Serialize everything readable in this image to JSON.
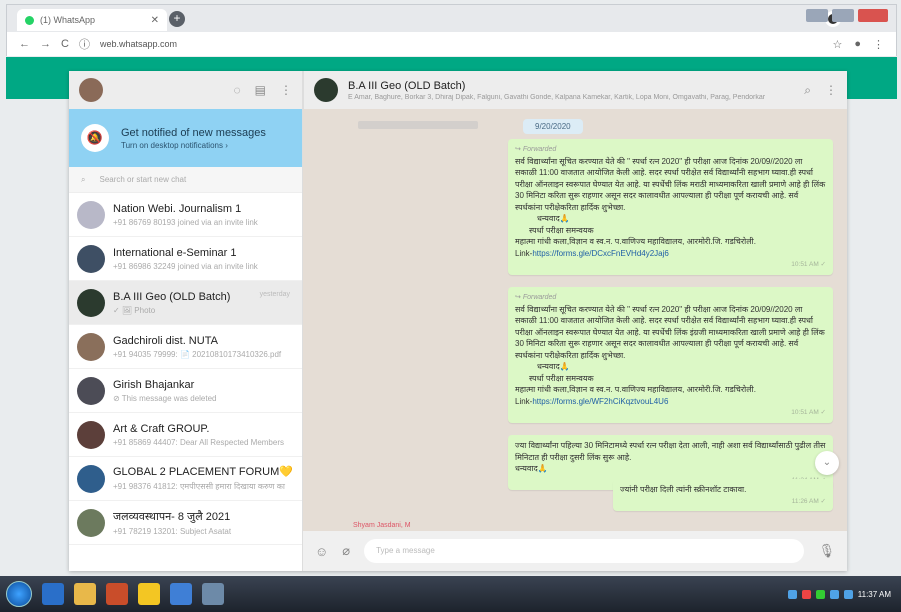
{
  "browser": {
    "tab_title": "(1) WhatsApp",
    "url": "web.whatsapp.com"
  },
  "notify": {
    "title": "Get notified of new messages",
    "subtitle": "Turn on desktop notifications ›"
  },
  "search": {
    "placeholder": "Search or start new chat"
  },
  "chats": [
    {
      "name": "Nation Webi. Journalism 1",
      "preview": "+91 86769 80193 joined via an invite link",
      "time": ""
    },
    {
      "name": "International e-Seminar 1",
      "preview": "+91 86986 32249 joined via an invite link",
      "time": ""
    },
    {
      "name": "B.A III Geo (OLD Batch)",
      "preview": "✓ 🖼 Photo",
      "time": "yesterday"
    },
    {
      "name": "Gadchiroli dist. NUTA",
      "preview": "+91 94035 79999: 📄 20210810173410326.pdf",
      "time": ""
    },
    {
      "name": "Girish Bhajankar",
      "preview": "⊘ This message was deleted",
      "time": ""
    },
    {
      "name": "Art & Craft  GROUP.",
      "preview": "+91 85869 44407: Dear All Respected Members",
      "time": ""
    },
    {
      "name": "GLOBAL 2 PLACEMENT FORUM💛",
      "preview": "+91 98376 41812: एमपीएससी हमारा दिखाया करुण का",
      "time": ""
    },
    {
      "name": "जलव्यवस्थापन- 8 जुलै 2021",
      "preview": "+91 78219 13201: Subject Asatat",
      "time": ""
    }
  ],
  "conversation": {
    "title": "B.A III Geo (OLD Batch)",
    "members": "E Amar, Baghure, Borkar 3, Dhiraj Dipak, Falguni, Gavathi Gonde, Kalpana Kamekar, Kartik, Lopa Moni, Omgavathi, Parag, Pendorkar",
    "date": "9/20/2020",
    "messages": [
      {
        "forwarded": "Forwarded",
        "text": "सर्व विद्यार्थ्यांना सूचित करण्यात येते की \" स्पर्धा रत्न 2020\" ही परीक्षा आज दिनांक 20/09//2020 ला सकाळी 11:00 वाजतात आयोजित केली आहे. सदर स्पर्धा परीक्षेत सर्व विद्यार्थ्यांनी सहभाग घ्यावा.ही स्पर्धा परीक्षा ऑनलाइन स्वरूपात घेण्यात येत आहे. या स्पर्धेची लिंक मराठी माध्यमाकरिता खाली प्रमाणे आहे ही लिंक 30 मिनिटा करिता सुरू राहणार असून सदर कालावधीत आपल्याला ही परीक्षा पूर्ण करायची आहे. सर्व स्पर्धकांना परीक्षेकरिता हार्दिक शुभेच्छा.",
        "sig1": "धन्यवाद🙏",
        "sig2": "स्पर्धा परीक्षा समन्वयक",
        "sig3": "महात्मा गांधी कला,विज्ञान व स्व.न. प.वाणिज्य महाविद्यालय, आरमोरी.जि. गडचिरोली.",
        "link_label": "Link-",
        "link": "https://forms.gle/DCxcFnEVHd4y2Jaj6",
        "time": "10:51 AM ✓"
      },
      {
        "forwarded": "Forwarded",
        "text": "सर्व विद्यार्थ्यांना सूचित करण्यात येते की \" स्पर्धा रत्न 2020\" ही परीक्षा आज दिनांक 20/09//2020 ला सकाळी 11:00 वाजतात आयोजित केली आहे. सदर स्पर्धा परीक्षेत सर्व विद्यार्थ्यांनी सहभाग घ्यावा.ही स्पर्धा परीक्षा ऑनलाइन स्वरूपात घेण्यात येत आहे. या स्पर्धेची लिंक इंग्रजी माध्यमाकरिता खाली प्रमाणे आहे ही लिंक 30 मिनिटा करिता सुरू राहणार असून सदर कालावधीत आपल्याला ही परीक्षा पूर्ण करायची आहे. सर्व स्पर्धकांना परीक्षेकरिता हार्दिक शुभेच्छा.",
        "sig1": "धन्यवाद🙏",
        "sig2": "स्पर्धा परीक्षा समन्वयक",
        "sig3": "महात्मा गांधी कला,विज्ञान व स्व.न. प.वाणिज्य महाविद्यालय, आरमोरी.जि. गडचिरोली.",
        "link_label": "Link-",
        "link": "https://forms.gle/WF2hCiKqztvouL4U6",
        "time": "10:51 AM ✓"
      },
      {
        "text": "ज्या विद्यार्थ्यांना पहिल्या 30 मिनिटामध्ये स्पर्धा रत्न परीक्षा देता आली, नाही अशा सर्व विद्यार्थ्यांसाठी पुढील तीस मिनिटात ही परीक्षा दुसरी लिंक सुरू आहे.",
        "sig1": "धन्यवाद🙏",
        "time": "11:24 AM ✓"
      },
      {
        "text": "ज्यांनी परीक्षा दिली त्यांनी स्क्रीनशॉट टाकावा.",
        "time": "11:26 AM ✓"
      }
    ],
    "compose_placeholder": "Type a message",
    "unread_label": "Shyam Jasdani, M"
  },
  "taskbar": {
    "clock": "11:37 AM"
  }
}
